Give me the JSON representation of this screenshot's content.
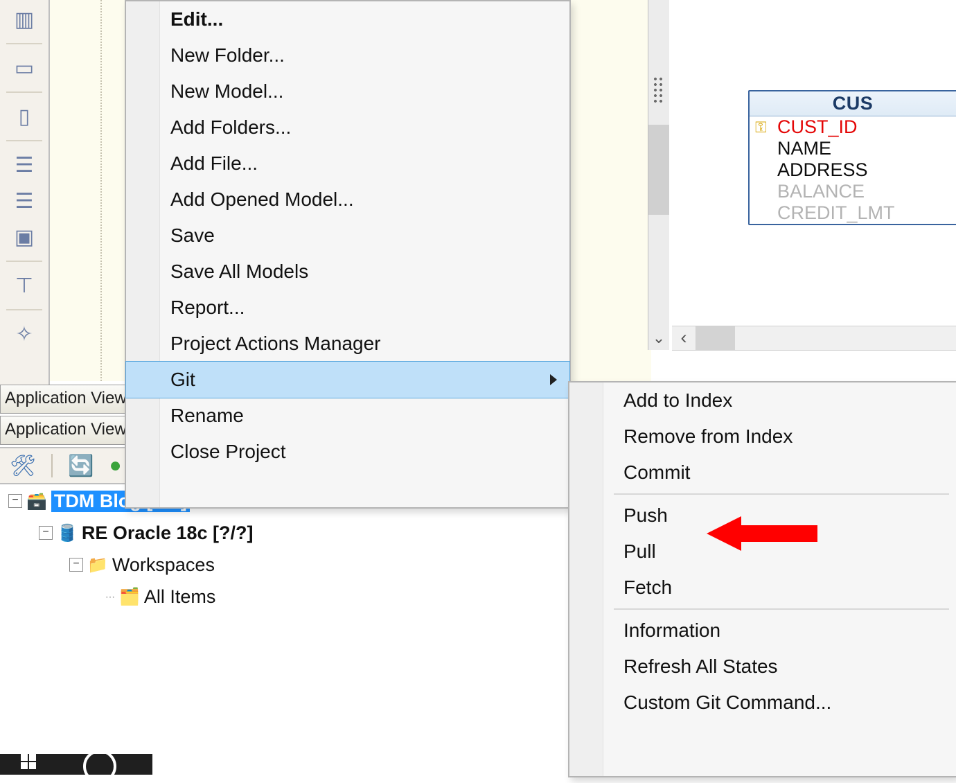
{
  "appview_tab_label": "Application View",
  "context_menu": {
    "items": [
      {
        "label": "Edit...",
        "bold": true
      },
      {
        "label": "New Folder..."
      },
      {
        "label": "New Model..."
      },
      {
        "label": "Add Folders..."
      },
      {
        "label": "Add File..."
      },
      {
        "label": "Add Opened Model..."
      },
      {
        "label": "Save"
      },
      {
        "label": "Save All Models"
      },
      {
        "label": "Report..."
      },
      {
        "label": "Project Actions Manager"
      },
      {
        "label": "Git",
        "submenu": true,
        "highlight": true
      },
      {
        "label": "Rename"
      },
      {
        "label": "Close Project"
      }
    ]
  },
  "git_submenu": {
    "items": [
      "Add to Index",
      "Remove from Index",
      "Commit",
      "Push",
      "Pull",
      "Fetch",
      "Information",
      "Refresh All States",
      "Custom Git Command..."
    ],
    "separators_after": [
      2,
      5
    ]
  },
  "tree": {
    "root": "TDM Blog [?/?]",
    "child1": "RE Oracle 18c [?/?]",
    "workspaces": "Workspaces",
    "allitems": "All Items"
  },
  "entity": {
    "title": "CUS",
    "fields": [
      {
        "name": "CUST_ID",
        "pk": true,
        "dim": false
      },
      {
        "name": "NAME",
        "pk": false,
        "dim": false
      },
      {
        "name": "ADDRESS",
        "pk": false,
        "dim": false
      },
      {
        "name": "BALANCE",
        "pk": false,
        "dim": true
      },
      {
        "name": "CREDIT_LMT",
        "pk": false,
        "dim": true
      }
    ]
  }
}
